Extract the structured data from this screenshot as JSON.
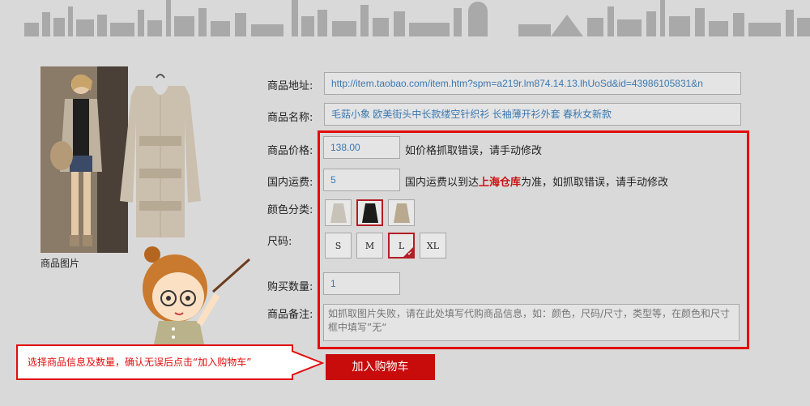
{
  "image_caption": "商品图片",
  "labels": {
    "url": "商品地址:",
    "name": "商品名称:",
    "price": "商品价格:",
    "shipping": "国内运费:",
    "color": "颜色分类:",
    "size": "尺码:",
    "quantity": "购买数量:",
    "notes": "商品备注:"
  },
  "fields": {
    "url": "http://item.taobao.com/item.htm?spm=a219r.lm874.14.13.lhUoSd&id=43986105831&n",
    "name": "毛菇小象 欧美街头中长款缕空针织衫 长袖薄开衫外套 春秋女新款",
    "price": "138.00",
    "shipping": "5",
    "quantity": "1",
    "notes": "如抓取图片失败，请在此处填写代购商品信息，如：颜色，尺码/尺寸，类型等，在颜色和尺寸框中填写”无“"
  },
  "hints": {
    "price": "如价格抓取错误，请手动修改",
    "shipping_prefix": "国内运费以到达",
    "shipping_highlight": "上海仓库",
    "shipping_suffix": "为准，如抓取错误，请手动修改"
  },
  "colors": {
    "options": [
      "beige",
      "black",
      "khaki"
    ],
    "selected": "black"
  },
  "sizes": {
    "options": [
      "S",
      "M",
      "L",
      "XL"
    ],
    "selected": "L"
  },
  "callout_text": "选择商品信息及数量，确认无误后点击“加入购物车”",
  "add_to_cart_label": "加入购物车",
  "accent_colors": {
    "red": "#e30d0d",
    "button": "#c80b0b",
    "link_blue": "#3b78b0"
  }
}
